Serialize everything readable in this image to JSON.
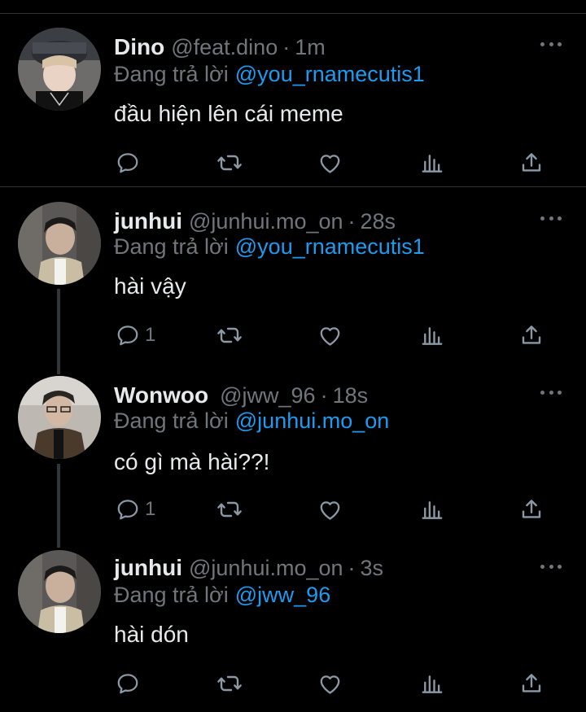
{
  "theme": {
    "background": "#000000",
    "text": "#e7e9ea",
    "muted": "#71767b",
    "accent": "#1d9bf0",
    "divider": "#2f3336"
  },
  "tweets": [
    {
      "display_name": "Dino",
      "handle": "@feat.dino",
      "separator": "·",
      "time": "1m",
      "reply_prefix": "Đang trả lời",
      "reply_to": "@you_rnamecutis1",
      "text": "đầu hiện lên cái meme",
      "reply_count": "",
      "icons": [
        "reply-icon",
        "retweet-icon",
        "like-icon",
        "views-icon",
        "share-icon"
      ]
    },
    {
      "display_name": "junhui",
      "handle": "@junhui.mo_on",
      "separator": "·",
      "time": "28s",
      "reply_prefix": "Đang trả lời",
      "reply_to": "@you_rnamecutis1",
      "text": "hài vậy",
      "reply_count": "1",
      "icons": [
        "reply-icon",
        "retweet-icon",
        "like-icon",
        "views-icon",
        "share-icon"
      ]
    },
    {
      "display_name": "Wonwoo",
      "handle": "@jww_96",
      "separator": "·",
      "time": "18s",
      "reply_prefix": "Đang trả lời",
      "reply_to": "@junhui.mo_on",
      "text": "có gì mà hài??!",
      "reply_count": "1",
      "icons": [
        "reply-icon",
        "retweet-icon",
        "like-icon",
        "views-icon",
        "share-icon"
      ]
    },
    {
      "display_name": "junhui",
      "handle": "@junhui.mo_on",
      "separator": "·",
      "time": "3s",
      "reply_prefix": "Đang trả lời",
      "reply_to": "@jww_96",
      "text": "hài dón",
      "reply_count": "",
      "icons": [
        "reply-icon",
        "retweet-icon",
        "like-icon",
        "views-icon",
        "share-icon"
      ]
    }
  ]
}
